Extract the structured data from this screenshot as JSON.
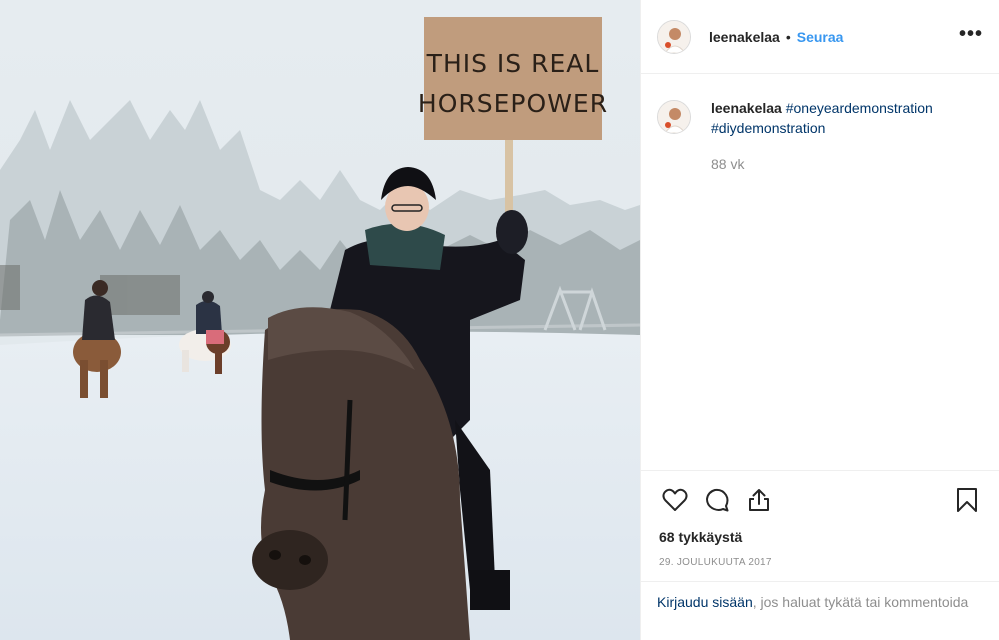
{
  "photo": {
    "sign_line_1": "THIS IS REAL",
    "sign_line_2": "HORSEPOWER"
  },
  "header": {
    "username": "leenakelaa",
    "separator": "•",
    "follow_label": "Seuraa",
    "more_icon": "more-horizontal-icon"
  },
  "caption": {
    "username": "leenakelaa",
    "hashtags": [
      "#oneyeardemonstration",
      "#diydemonstration"
    ],
    "age": "88 vk"
  },
  "actions": {
    "like_icon": "heart-icon",
    "comment_icon": "comment-icon",
    "share_icon": "share-icon",
    "save_icon": "bookmark-icon"
  },
  "likes_text": "68 tykkäystä",
  "date_text": "29. JOULUKUUTA 2017",
  "login": {
    "link": "Kirjaudu sisään",
    "rest": ", jos haluat tykätä tai kommentoida"
  },
  "colors": {
    "link_blue": "#3897f0",
    "hashtag_navy": "#003569",
    "muted_gray": "#8e8e8e"
  }
}
